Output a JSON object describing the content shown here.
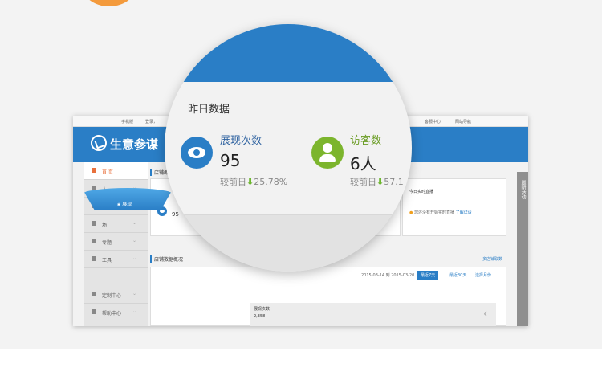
{
  "window": {
    "logo_text": "生意参谋",
    "topbar": {
      "mobile": "手机版",
      "login": "登录，",
      "service": "客服中心",
      "nav": "网站导航"
    },
    "sidebar": [
      {
        "label": "首 页",
        "icon": "home-icon"
      },
      {
        "label": "人",
        "icon": "user-icon"
      },
      {
        "label": "货",
        "icon": "goods-icon"
      },
      {
        "label": "场",
        "icon": "store-icon"
      },
      {
        "label": "专题",
        "icon": "topic-icon"
      },
      {
        "label": "工具",
        "icon": "tool-icon"
      },
      {
        "label": "定制中心",
        "icon": "custom-icon"
      },
      {
        "label": "帮助中心",
        "icon": "help-icon"
      }
    ],
    "right_strip": "最新活动",
    "shop_overview_title": "店铺概况",
    "mini_value": "95",
    "realtime_title": "今日实时直播",
    "realtime_notice": "您还没有开始实时直播",
    "realtime_link": "了解详请",
    "shop_data_title": "店铺数据概况",
    "more_link": "多店铺取数",
    "date_range": "2015-03-14 到 2015-03-20",
    "btn_recent7": "最近7天",
    "btn_recent30": "最近30天",
    "btn_select_month": "选择月份",
    "funnel_label": "展现",
    "metric_label": "展现次数",
    "metric_value": "2,358"
  },
  "magnifier": {
    "title": "昨日数据",
    "metrics": [
      {
        "label": "展现次数",
        "value": "95",
        "compare_label": "较前日",
        "change": "25.78%",
        "label_color": "#2a5f9e",
        "icon": "eye-icon"
      },
      {
        "label": "访客数",
        "value": "6人",
        "compare_label": "较前日",
        "change": "57.1",
        "label_color": "#6a9c24",
        "icon": "user-icon"
      }
    ]
  },
  "colors": {
    "brand_blue": "#2a7ec6",
    "accent_orange": "#e8703c",
    "green": "#7cb52d"
  }
}
